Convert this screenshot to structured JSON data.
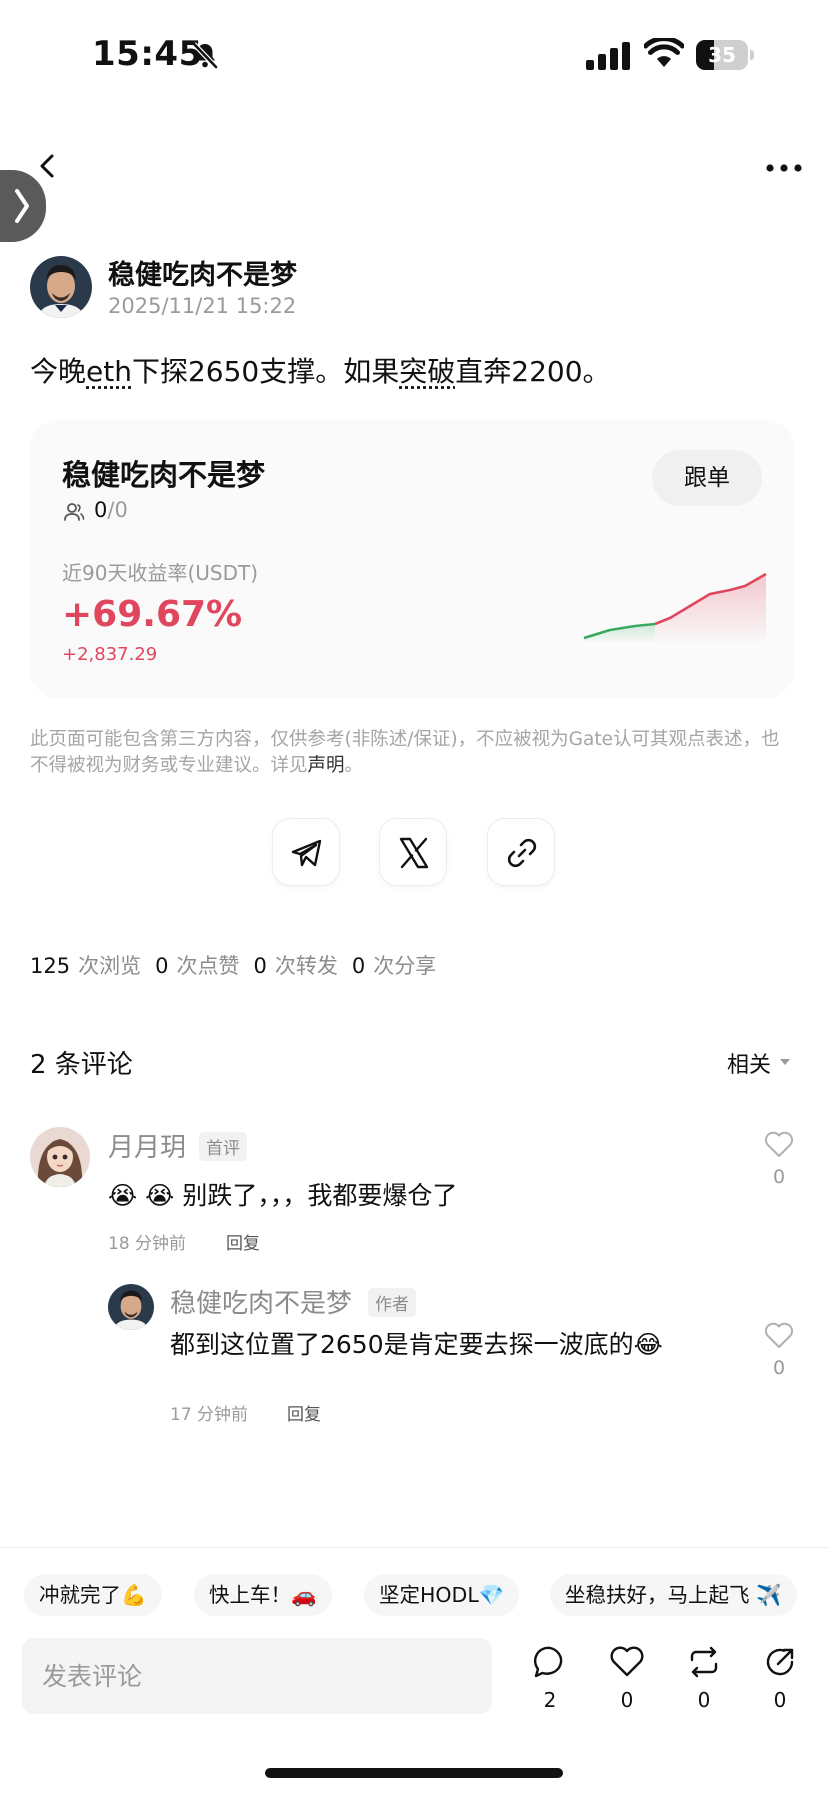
{
  "status_bar": {
    "time": "15:45",
    "battery": "35",
    "battery_level": 0.35
  },
  "header": {
    "back_icon": "chevron-left-icon",
    "more_icon": "more-horizontal-icon"
  },
  "post": {
    "author": "稳健吃肉不是梦",
    "date": "2025/11/21 15:22",
    "body_parts": [
      "今晚",
      "eth",
      "下探2650支撑。如果",
      "突破",
      "直奔2200。"
    ]
  },
  "trader_card": {
    "name": "稳健吃肉不是梦",
    "followers_current": "0",
    "followers_total": "/0",
    "follow_label": "跟单",
    "metric_label": "近90天收益率(USDT)",
    "metric_value": "+69.67%",
    "metric_sub": "+2,837.29",
    "colors": {
      "positive": "#e0465e",
      "early_trend": "#3aa861"
    }
  },
  "disclaimer": {
    "text": "此页面可能包含第三方内容，仅供参考(非陈述/保证)，不应被视为Gate认可其观点表述，也不得被视为财务或专业建议。详见",
    "link": "声明",
    "end": "。"
  },
  "share": [
    "telegram-icon",
    "x-icon",
    "link-icon"
  ],
  "stats": {
    "views": "125",
    "views_unit": "次浏览",
    "likes": "0",
    "likes_unit": "次点赞",
    "reposts": "0",
    "reposts_unit": "次转发",
    "shares": "0",
    "shares_unit": "次分享"
  },
  "comments_section": {
    "title": "2 条评论",
    "sort": "相关",
    "comments": [
      {
        "name": "月月玥",
        "tag": "首评",
        "text": "😭 😭 别跌了，，，我都要爆仓了",
        "time": "18 分钟前",
        "reply": "回复",
        "likes": "0"
      },
      {
        "name": "稳健吃肉不是梦",
        "tag": "作者",
        "text": "都到这位置了2650是肯定要去探一波底的😂",
        "time": "17 分钟前",
        "reply": "回复",
        "likes": "0"
      }
    ]
  },
  "quick_replies": [
    "冲就完了💪",
    "快上车！🚗",
    "坚定HODL💎",
    "坐稳扶好，马上起飞 ✈️"
  ],
  "bottom_bar": {
    "input_placeholder": "发表评论",
    "actions": [
      {
        "icon": "comment-icon",
        "count": "2"
      },
      {
        "icon": "heart-icon",
        "count": "0"
      },
      {
        "icon": "repost-icon",
        "count": "0"
      },
      {
        "icon": "share-icon",
        "count": "0"
      }
    ]
  }
}
